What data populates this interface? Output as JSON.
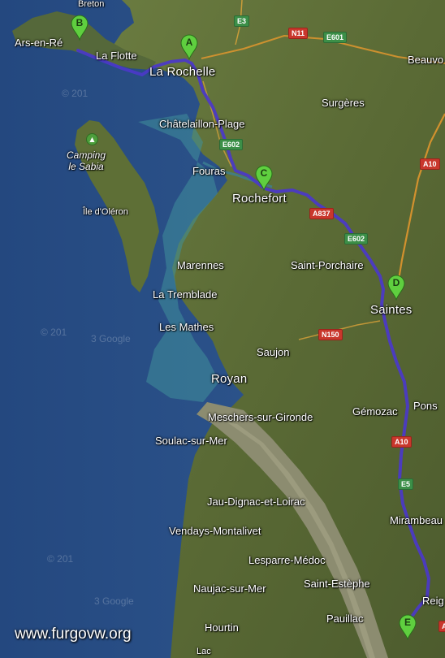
{
  "map": {
    "colors": {
      "sea": "#2a4f86",
      "land": "#5d6f37",
      "estuary": "#8f8f74",
      "route": "#4b38c9",
      "marker": "#5fcf3f",
      "motorway": "#e0962e"
    },
    "place_labels": {
      "breton": "Breton",
      "ars_en_re": "Ars-en-Ré",
      "la_flotte": "La Flotte",
      "la_rochelle": "La Rochelle",
      "beauvo": "Beauvo",
      "surgeres": "Surgères",
      "chatelaillon": "Châtelaillon-Plage",
      "camping": "Camping\nle Sabia",
      "fouras": "Fouras",
      "rochefort": "Rochefort",
      "ile_oleron": "Île d'Oléron",
      "marennes": "Marennes",
      "saint_porchaire": "Saint-Porchaire",
      "la_tremblade": "La Tremblade",
      "saintes": "Saintes",
      "les_mathes": "Les Mathes",
      "saujon": "Saujon",
      "royan": "Royan",
      "gemozac": "Gémozac",
      "pons": "Pons",
      "meschers": "Meschers-sur-Gironde",
      "soulac": "Soulac-sur-Mer",
      "jau_dignac": "Jau-Dignac-et-Loirac",
      "mirambeau": "Mirambeau",
      "vendays": "Vendays-Montalivet",
      "lesparre": "Lesparre-Médoc",
      "naujac": "Naujac-sur-Mer",
      "saint_estephe": "Saint-Estèphe",
      "reignac": "Reig",
      "hourtin": "Hourtin",
      "pauillac": "Pauillac",
      "lac": "Lac"
    },
    "road_shields": {
      "e3": "E3",
      "n11": "N11",
      "e601": "E601",
      "e602_north": "E602",
      "e602_south": "E602",
      "a837": "A837",
      "a10_north": "A10",
      "a10_south": "A10",
      "n150": "N150",
      "e5": "E5",
      "a_south": "A"
    },
    "markers": {
      "a": "A",
      "b": "B",
      "c": "C",
      "d": "D",
      "e": "E"
    },
    "watermarks": {
      "w1": "© 201",
      "w2": "© 201",
      "w3": "3 Google",
      "w4": "© 201",
      "w5": "3 Google"
    },
    "credit": "www.furgovw.org"
  }
}
